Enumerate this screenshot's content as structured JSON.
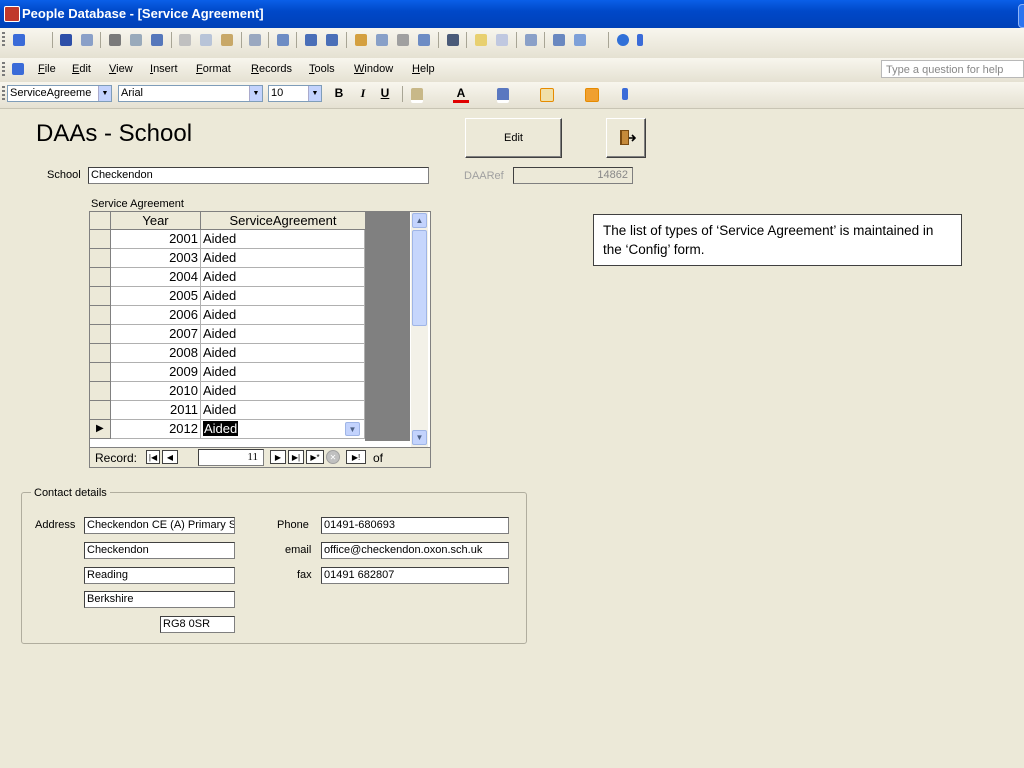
{
  "window": {
    "title": "People Database - [Service Agreement]"
  },
  "menu": {
    "items": [
      "File",
      "Edit",
      "View",
      "Insert",
      "Format",
      "Records",
      "Tools",
      "Window",
      "Help"
    ],
    "help_placeholder": "Type a question for help"
  },
  "toolbar": {
    "object_combo": "ServiceAgreeme",
    "font_combo": "Arial",
    "size_combo": "10",
    "bold": "B",
    "italic": "I",
    "underline": "U",
    "font_color_glyph": "A"
  },
  "form": {
    "heading": "DAAs - School",
    "edit_button": "Edit",
    "school_label": "School",
    "school_value": "Checkendon",
    "daaref_label": "DAARef",
    "daaref_value": "14862",
    "subform_label": "Service Agreement",
    "grid_headers": {
      "year": "Year",
      "agreement": "ServiceAgreement"
    },
    "grid_rows": [
      {
        "year": "2001",
        "agreement": "Aided"
      },
      {
        "year": "2003",
        "agreement": "Aided"
      },
      {
        "year": "2004",
        "agreement": "Aided"
      },
      {
        "year": "2005",
        "agreement": "Aided"
      },
      {
        "year": "2006",
        "agreement": "Aided"
      },
      {
        "year": "2007",
        "agreement": "Aided"
      },
      {
        "year": "2008",
        "agreement": "Aided"
      },
      {
        "year": "2009",
        "agreement": "Aided"
      },
      {
        "year": "2010",
        "agreement": "Aided"
      },
      {
        "year": "2011",
        "agreement": "Aided"
      },
      {
        "year": "2012",
        "agreement": "Aided"
      }
    ],
    "record_nav": {
      "label": "Record:",
      "current": "11",
      "of": "of"
    },
    "contact": {
      "legend": "Contact details",
      "address_label": "Address",
      "address_lines": [
        "Checkendon CE (A) Primary S",
        "Checkendon",
        "Reading",
        "Berkshire"
      ],
      "postcode": "RG8 0SR",
      "phone_label": "Phone",
      "phone_value": "01491-680693",
      "email_label": "email",
      "email_value": "office@checkendon.oxon.sch.uk",
      "fax_label": "fax",
      "fax_value": "01491 682807"
    }
  },
  "note": {
    "text": "The list of types of ‘Service Agreement’ is maintained in the ‘Config’ form."
  }
}
